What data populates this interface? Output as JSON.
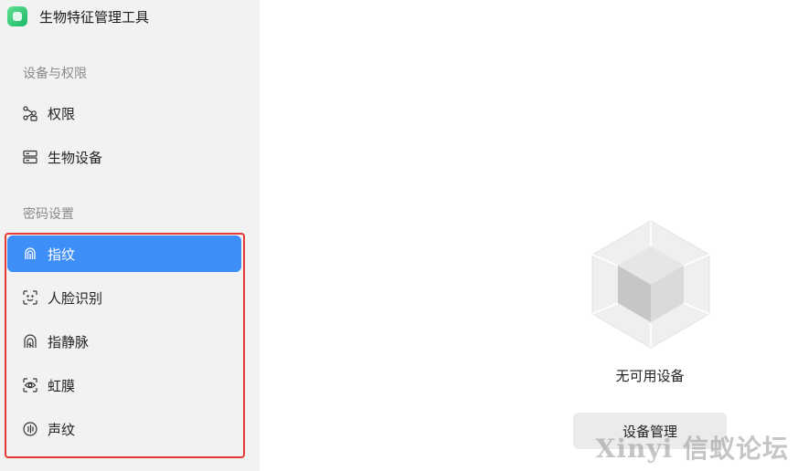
{
  "app": {
    "title": "生物特征管理工具",
    "icon": "app-logo-icon",
    "accent": "#3e8ef7"
  },
  "sidebar": {
    "sections": [
      {
        "title": "设备与权限",
        "items": [
          {
            "label": "权限",
            "icon": "permission-nodes-icon"
          },
          {
            "label": "生物设备",
            "icon": "device-server-icon"
          }
        ]
      },
      {
        "title": "密码设置",
        "items": [
          {
            "label": "指纹",
            "icon": "fingerprint-icon",
            "active": true
          },
          {
            "label": "人脸识别",
            "icon": "face-scan-icon"
          },
          {
            "label": "指静脉",
            "icon": "finger-vein-icon"
          },
          {
            "label": "虹膜",
            "icon": "iris-eye-icon"
          },
          {
            "label": "声纹",
            "icon": "voiceprint-icon"
          }
        ]
      }
    ],
    "highlight_color": "#e53935"
  },
  "main": {
    "empty_state": {
      "icon": "empty-cube-icon",
      "text": "无可用设备"
    },
    "manage_button": "设备管理"
  },
  "watermark": "Xinyi 信蚁论坛"
}
